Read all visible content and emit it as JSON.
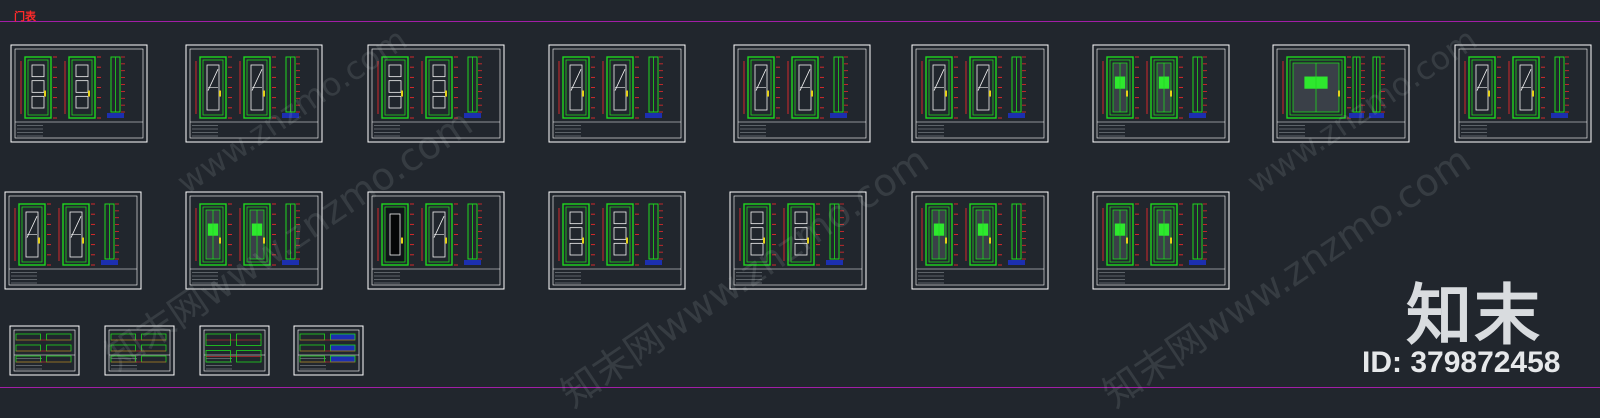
{
  "header": {
    "title_mark": "门表"
  },
  "watermark": {
    "text_a": "知末网www.znzmo.com",
    "text_b": "www.znzmo.com"
  },
  "logo": {
    "text": "知末",
    "id_label": "ID: 379872458"
  },
  "colors": {
    "background": "#21262d",
    "rule_line": "#a21ea6",
    "frame": "#ffffff",
    "door": "#1fd81f",
    "dimension": "#ff2a2a",
    "door_dark": "#101418",
    "panel_fill": "#2ee82e",
    "base_fill": "#1c2fb0",
    "accent": "#e6d21a"
  },
  "sheets": {
    "row1": [
      {
        "type": "panel-double"
      },
      {
        "type": "diag-single"
      },
      {
        "type": "panel-double"
      },
      {
        "type": "diag-single"
      },
      {
        "type": "diag-single"
      },
      {
        "type": "diag-single"
      },
      {
        "type": "glass-double"
      },
      {
        "type": "glass-wide"
      },
      {
        "type": "diag-single"
      }
    ],
    "row2": [
      {
        "type": "diag-double"
      },
      {
        "type": "glass-single"
      },
      {
        "type": "dark-single"
      },
      {
        "type": "panel-double"
      },
      {
        "type": "panel-double"
      },
      {
        "type": "glass-single"
      },
      {
        "type": "glass-double"
      }
    ],
    "row3": [
      {
        "type": "node"
      },
      {
        "type": "node"
      },
      {
        "type": "node-sparse"
      },
      {
        "type": "node-blue"
      }
    ]
  }
}
